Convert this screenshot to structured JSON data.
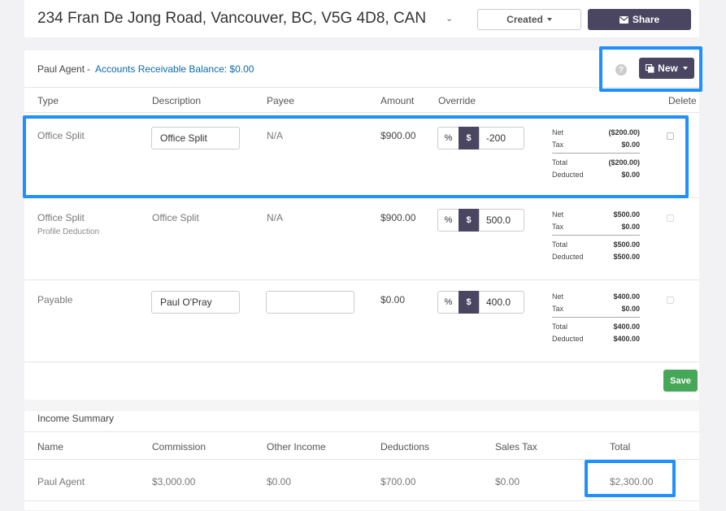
{
  "property": {
    "address": "234 Fran De Jong Road, Vancouver, BC, V5G 4D8, CAN",
    "status_button": "Created",
    "share_button": "Share"
  },
  "ledger": {
    "agent_name": "Paul Agent",
    "separator": "-",
    "ar_balance": "Accounts Receivable Balance: $0.00",
    "help_icon": "?",
    "new_button": "New",
    "columns": [
      "Type",
      "Description",
      "Payee",
      "Amount",
      "Override",
      "Delete"
    ],
    "rows": [
      {
        "type": "Office Split",
        "subtype": "",
        "description": "Office Split",
        "payee": "N/A",
        "amount": "$900.00",
        "pct_label": "%",
        "dollar_label": "$",
        "override": "-200",
        "breakdown": {
          "net_label": "Net",
          "net": "($200.00)",
          "tax_label": "Tax",
          "tax": "$0.00",
          "total_label": "Total",
          "total": "($200.00)",
          "deducted_label": "Deducted",
          "deducted": "$0.00"
        }
      },
      {
        "type": "Office Split",
        "subtype": "Profile Deduction",
        "description": "Office Split",
        "payee": "N/A",
        "amount": "$900.00",
        "pct_label": "%",
        "dollar_label": "$",
        "override": "500.0",
        "breakdown": {
          "net_label": "Net",
          "net": "$500.00",
          "tax_label": "Tax",
          "tax": "$0.00",
          "total_label": "Total",
          "total": "$500.00",
          "deducted_label": "Deducted",
          "deducted": "$500.00"
        }
      },
      {
        "type": "Payable",
        "subtype": "",
        "description": "Paul O'Pray",
        "payee": "",
        "amount": "$0.00",
        "pct_label": "%",
        "dollar_label": "$",
        "override": "400.0",
        "breakdown": {
          "net_label": "Net",
          "net": "$400.00",
          "tax_label": "Tax",
          "tax": "$0.00",
          "total_label": "Total",
          "total": "$400.00",
          "deducted_label": "Deducted",
          "deducted": "$400.00"
        }
      }
    ],
    "save_button": "Save"
  },
  "income_summary": {
    "title": "Income Summary",
    "columns": [
      "Name",
      "Commission",
      "Other Income",
      "Deductions",
      "Sales Tax",
      "Total"
    ],
    "row": {
      "name": "Paul Agent",
      "commission": "$3,000.00",
      "other_income": "$0.00",
      "deductions": "$700.00",
      "sales_tax": "$0.00",
      "total": "$2,300.00"
    }
  },
  "colors": {
    "accent_dark": "#4a4560",
    "link": "#0b6aa8",
    "save_green": "#46a758",
    "highlight": "#1e90ff"
  },
  "icons": [
    "chevron-down-icon",
    "envelope-icon",
    "help-icon",
    "copy-icon",
    "caret-down-icon"
  ]
}
